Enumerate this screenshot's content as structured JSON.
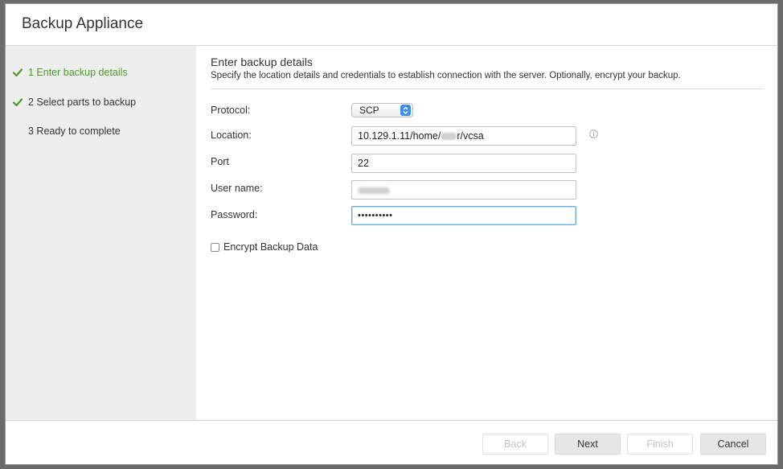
{
  "dialog": {
    "title": "Backup Appliance"
  },
  "steps": [
    {
      "label": "1 Enter backup details",
      "status": "active"
    },
    {
      "label": "2 Select parts to backup",
      "status": "done"
    },
    {
      "label": "3 Ready to complete",
      "status": "pending"
    }
  ],
  "section": {
    "title": "Enter backup details",
    "description": "Specify the location details and credentials to establish connection with the server. Optionally, encrypt your backup."
  },
  "form": {
    "protocol_label": "Protocol:",
    "protocol_value": "SCP",
    "location_label": "Location:",
    "location_prefix": "10.129.1.11/home/",
    "location_suffix": "r/vcsa",
    "port_label": "Port",
    "port_value": "22",
    "username_label": "User name:",
    "password_label": "Password:",
    "password_value": "••••••••••",
    "encrypt_label": "Encrypt Backup Data"
  },
  "buttons": {
    "back": "Back",
    "next": "Next",
    "finish": "Finish",
    "cancel": "Cancel"
  },
  "colors": {
    "accent_green": "#4c9a2a",
    "focus_blue": "#6aaed6",
    "select_blue": "#3b8fe8"
  }
}
